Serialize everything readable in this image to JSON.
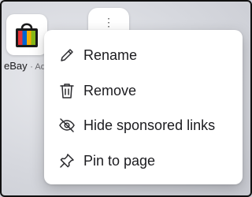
{
  "tile": {
    "name": "eBay",
    "suffix": "· Ad",
    "icon": "shopping-bag-icon"
  },
  "trigger": {
    "icon": "more-options-icon",
    "glyph": "⋮"
  },
  "menu": {
    "items": [
      {
        "label": "Rename",
        "icon": "pencil-icon"
      },
      {
        "label": "Remove",
        "icon": "trash-icon"
      },
      {
        "label": "Hide sponsored links",
        "icon": "eye-off-icon"
      },
      {
        "label": "Pin to page",
        "icon": "pin-icon"
      }
    ]
  },
  "colors": {
    "menu_bg": "#ffffff",
    "text": "#1b1b1f",
    "bag_black": "#1a1a1a",
    "bag_red": "#e53238",
    "bag_blue": "#0064d2",
    "bag_yellow": "#f5af02",
    "bag_green": "#86b817"
  }
}
